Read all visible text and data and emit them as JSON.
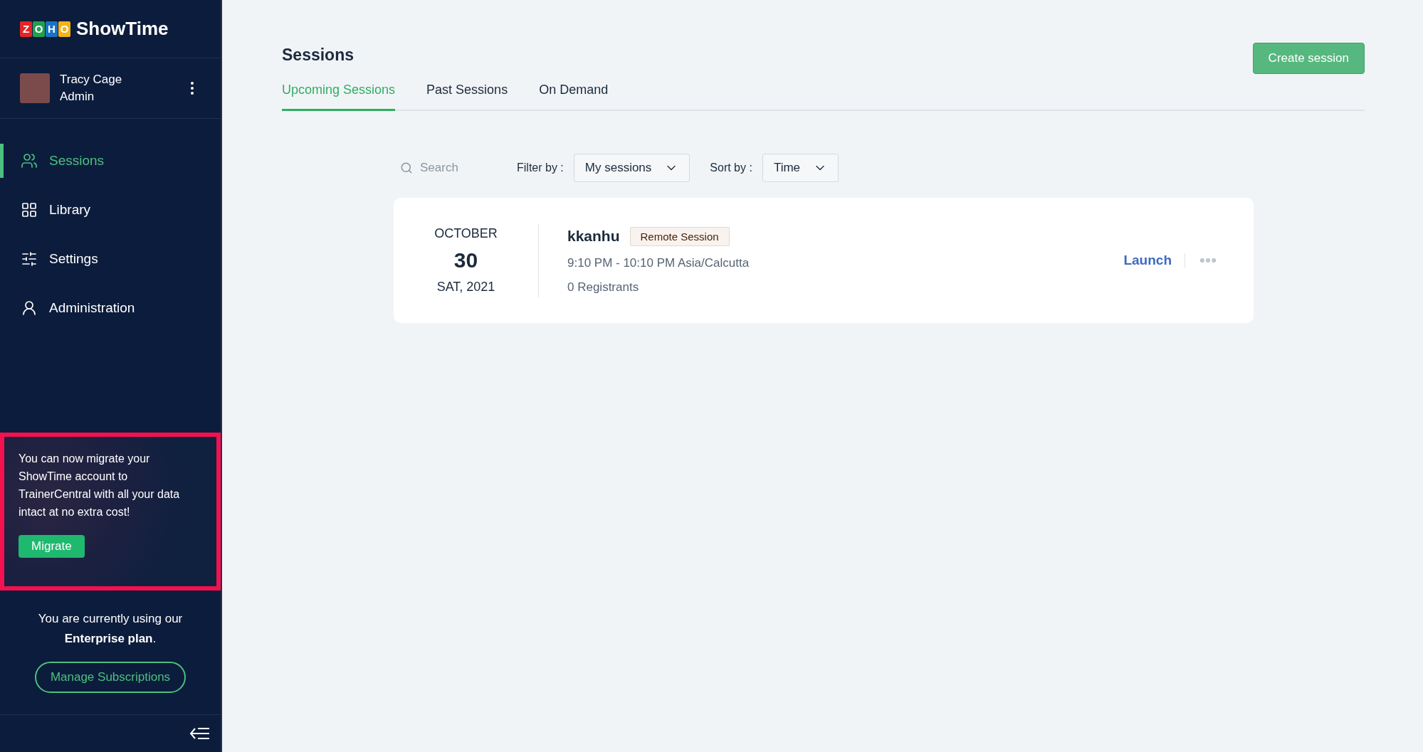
{
  "sidebar": {
    "logo": {
      "letters": [
        {
          "char": "Z",
          "color": "#e42527"
        },
        {
          "char": "O",
          "color": "#21a150"
        },
        {
          "char": "H",
          "color": "#1a73c7"
        },
        {
          "char": "O",
          "color": "#f2b318"
        }
      ],
      "product": "ShowTime"
    },
    "user": {
      "name": "Tracy Cage",
      "role": "Admin"
    },
    "nav": [
      {
        "kind": "sessions",
        "label": "Sessions",
        "selected": true
      },
      {
        "kind": "library",
        "label": "Library",
        "selected": false
      },
      {
        "kind": "settings",
        "label": "Settings",
        "selected": false
      },
      {
        "kind": "admin",
        "label": "Administration",
        "selected": false
      }
    ],
    "promo": {
      "text": "You can now migrate your ShowTime account to TrainerCentral with all your data intact at no extra cost!",
      "button": "Migrate",
      "highlighted": true
    },
    "plan": {
      "text": "You are currently using our **Enterprise plan**.",
      "button": "Manage Subscriptions"
    }
  },
  "header": {
    "title": "Sessions",
    "create_button": "Create session"
  },
  "tabs": [
    {
      "label": "Upcoming Sessions",
      "selected": true
    },
    {
      "label": "Past Sessions",
      "selected": false
    },
    {
      "label": "On Demand",
      "selected": false
    }
  ],
  "filters": {
    "search": {
      "placeholder": "Search"
    },
    "filter_label": "Filter by :",
    "filter_value": "My sessions",
    "sort_label": "Sort by :",
    "sort_value": "Time"
  },
  "sessions": [
    {
      "month": "OCTOBER",
      "day": "30",
      "weekday_year": "SAT, 2021",
      "name": "kkanhu",
      "tag": "Remote Session",
      "time": "9:10 PM - 10:10 PM Asia/Calcutta",
      "registrants": "0 Registrants",
      "action": "Launch"
    }
  ]
}
